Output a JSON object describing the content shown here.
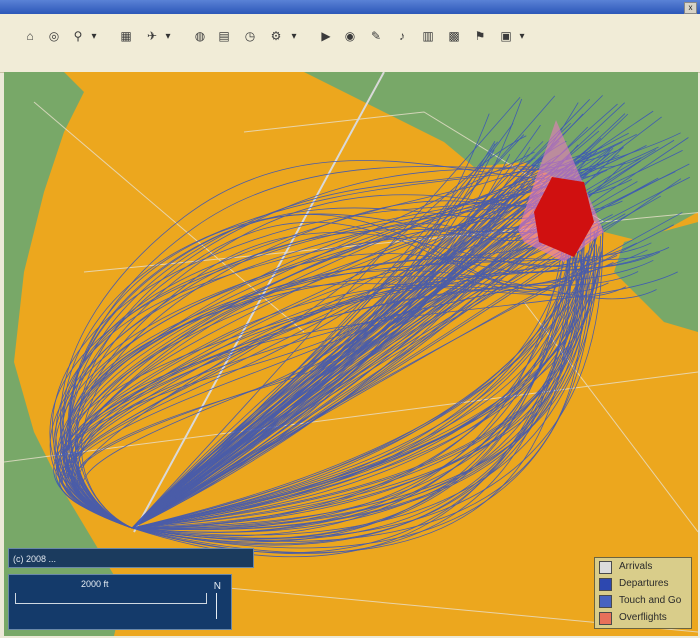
{
  "toolbar": {
    "buttons": [
      {
        "name": "home-button",
        "glyph": "⌂"
      },
      {
        "name": "globe-button",
        "glyph": "◎"
      },
      {
        "name": "zoom-button",
        "glyph": "⚲"
      },
      {
        "name": "layers-button",
        "glyph": "▦"
      },
      {
        "name": "aircraft-button",
        "glyph": "✈"
      },
      {
        "name": "world-button",
        "glyph": "◍"
      },
      {
        "name": "chart-button",
        "glyph": "▤"
      },
      {
        "name": "clock-button",
        "glyph": "◷"
      },
      {
        "name": "tools-button",
        "glyph": "⚙"
      },
      {
        "name": "play-button",
        "glyph": "▶"
      },
      {
        "name": "target-button",
        "glyph": "◉"
      },
      {
        "name": "edit-button",
        "glyph": "✎"
      },
      {
        "name": "sound-button",
        "glyph": "♪"
      },
      {
        "name": "report-button",
        "glyph": "▥"
      },
      {
        "name": "grid-button",
        "glyph": "▩"
      },
      {
        "name": "flag-button",
        "glyph": "⚑"
      },
      {
        "name": "export-button",
        "glyph": "▣"
      }
    ]
  },
  "map": {
    "copyright": "(c) 2008 ...",
    "scale_label": "2000 ft",
    "north_label": "N",
    "colors": {
      "water": "#eca71e",
      "land": "#78a868",
      "tracks": "#3a55b8",
      "noise_zone": "#d01010",
      "noise_zone_outer": "#e879c0"
    }
  },
  "legend": {
    "items": [
      {
        "label": "Arrivals",
        "color": "#dcdcdc"
      },
      {
        "label": "Departures",
        "color": "#2d48b0"
      },
      {
        "label": "Touch and Go",
        "color": "#4763c0"
      },
      {
        "label": "Overflights",
        "color": "#e8705a"
      }
    ]
  }
}
